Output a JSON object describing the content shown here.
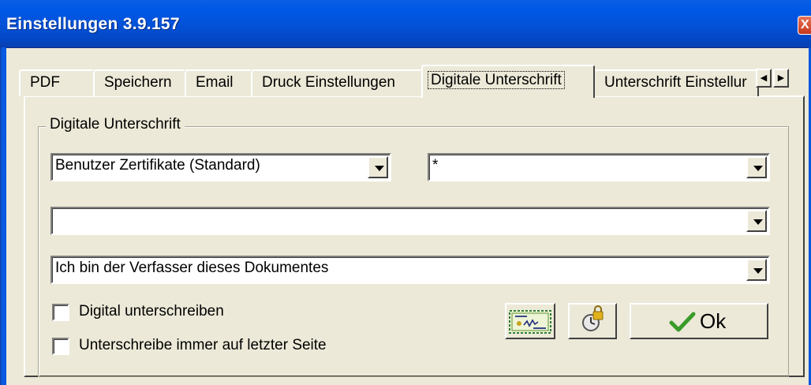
{
  "window": {
    "title": "Einstellungen 3.9.157",
    "close_glyph": "X"
  },
  "tabs": [
    {
      "label": "PDF",
      "active": false
    },
    {
      "label": "Speichern",
      "active": false
    },
    {
      "label": "Email",
      "active": false
    },
    {
      "label": "Druck Einstellungen",
      "active": false
    },
    {
      "label": "Digitale Unterschrift",
      "active": true
    },
    {
      "label": "Unterschrift Einstellur",
      "active": false
    }
  ],
  "tab_scroll": {
    "left": "◀",
    "right": "▶"
  },
  "group": {
    "label": "Digitale Unterschrift",
    "certificate_store": {
      "value": "Benutzer Zertifikate (Standard)"
    },
    "certificate_filter": {
      "value": "*"
    },
    "certificate": {
      "value": ""
    },
    "reason": {
      "value": "Ich bin der Verfasser dieses Dokumentes"
    },
    "sign_digitally": {
      "label": "Digital unterschreiben",
      "checked": false
    },
    "sign_last_page": {
      "label": "Unterschreibe immer auf letzter Seite",
      "checked": false
    }
  },
  "buttons": {
    "certificate_icon": "certificate-icon",
    "lock_icon": "timestamp-lock-icon",
    "ok_label": "Ok"
  },
  "colors": {
    "titlebar": "#0351d7",
    "face": "#ece9d8",
    "ok_check": "#3a9b2a"
  }
}
